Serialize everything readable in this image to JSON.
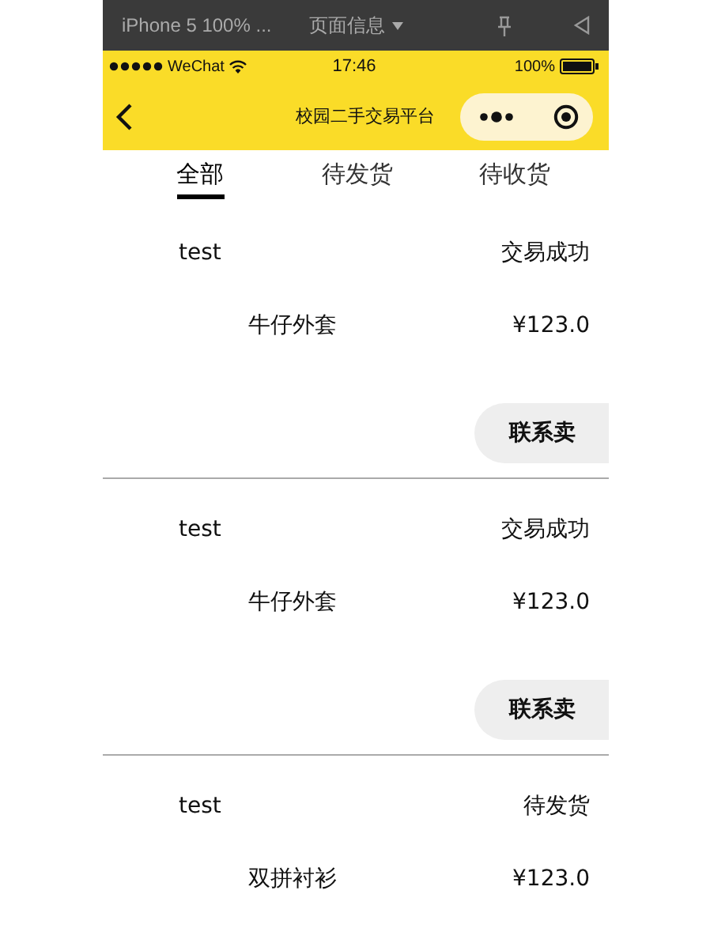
{
  "devtools_bar": {
    "device": "iPhone 5 100% ...",
    "page_info": "页面信息"
  },
  "status_bar": {
    "carrier": "WeChat",
    "time": "17:46",
    "battery": "100%"
  },
  "nav_bar": {
    "title": "校园二手交易平台"
  },
  "tabs": [
    {
      "label": "全部",
      "selected": true
    },
    {
      "label": "待发货",
      "selected": false
    },
    {
      "label": "待收货",
      "selected": false
    }
  ],
  "orders": [
    {
      "user": "test",
      "status": "交易成功",
      "product": "牛仔外套",
      "price": "¥123.0",
      "button": "联系卖"
    },
    {
      "user": "test",
      "status": "交易成功",
      "product": "牛仔外套",
      "price": "¥123.0",
      "button": "联系卖"
    },
    {
      "user": "test",
      "status": "待发货",
      "product": "双拼衬衫",
      "price": "¥123.0"
    }
  ]
}
